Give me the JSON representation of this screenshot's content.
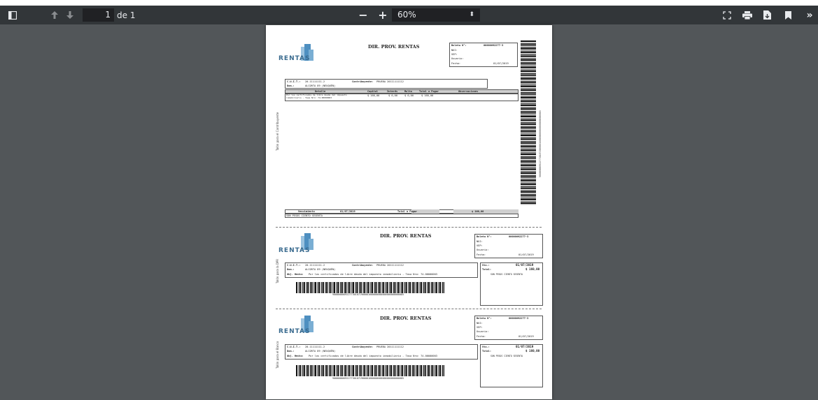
{
  "toolbar": {
    "page_current": "1",
    "page_of": "de 1",
    "zoom_minus": "−",
    "zoom_plus": "+",
    "zoom_value": "60%",
    "icons": [
      "sidebar-toggle-icon",
      "arrow-up-icon",
      "arrow-down-icon",
      "fit-page-icon",
      "print-icon",
      "download-icon",
      "bookmark-icon",
      "more-icon"
    ]
  },
  "doc": {
    "header": "DIR. PROV. RENTAS",
    "logo": "RENTAS",
    "logo_sub": "Dirección Provincial de Rentas",
    "boleta_label": "Boleta N°:",
    "boleta_num": "00000092277-3",
    "nui": "NUI:",
    "vep": "VEP:",
    "usuario": "Usuario:",
    "fecha_label": "Fecha:",
    "fecha": "01/07/2019",
    "cuit_label": "C.U.I.T.:",
    "cuit": "20-11111111-2",
    "contrib_label": "Contribuyente:",
    "contrib": "PRUEBA 20111111112",
    "dom_label": "Dom.:",
    "dom": "ALCORTA 89 (NEUQUÉN)",
    "cols": [
      "Detalle",
      "Capital",
      "Interés",
      "Multa",
      "Total a Pagar",
      "Observaciones"
    ],
    "row_detalle": "Por los certificados de libre deuda del impuesto inmobiliario - Tasa Nro: 74-00000003",
    "row_capital": "$ 160,00",
    "row_interes": "$ 0,00",
    "row_multa": "$ 0,00",
    "row_total": "$ 160,00",
    "venc_label": "Vencimiento",
    "venc": "01/07/2019",
    "tp_label": "Total a Pagar",
    "tp": "$ 160,00",
    "son": "SON PESOS CIENTO SESENTA",
    "talon1": "Talón para el Contribuyente",
    "talon2": "Talón para la DPR",
    "talon3": "Talón para el Banco",
    "vert_code": "90800000092277301071900001600000000000000000000085",
    "obj_label": "Obj. Hecho:",
    "obj": "Por los certificados de libre deuda del impuesto inmobiliario - Tasa Nro: 74-00000003",
    "vto_label": "Vto.:",
    "total_label": "Total:",
    "barcode_num": "90800000092277301071900001600000000000000000000085"
  }
}
